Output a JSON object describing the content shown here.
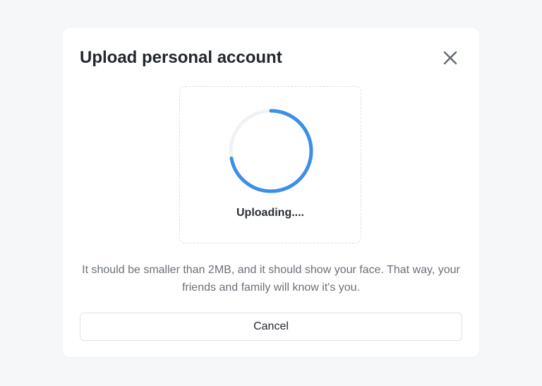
{
  "modal": {
    "title": "Upload personal account",
    "close_icon": "close-icon",
    "upload": {
      "status": "Uploading....",
      "progress_fraction": 0.72,
      "colors": {
        "track": "#f1f2f4",
        "progress": "#3b8fe6"
      }
    },
    "help_text": "It should be smaller than 2MB, and it should show your face. That way, your friends and family will know it's you.",
    "cancel_label": "Cancel"
  }
}
